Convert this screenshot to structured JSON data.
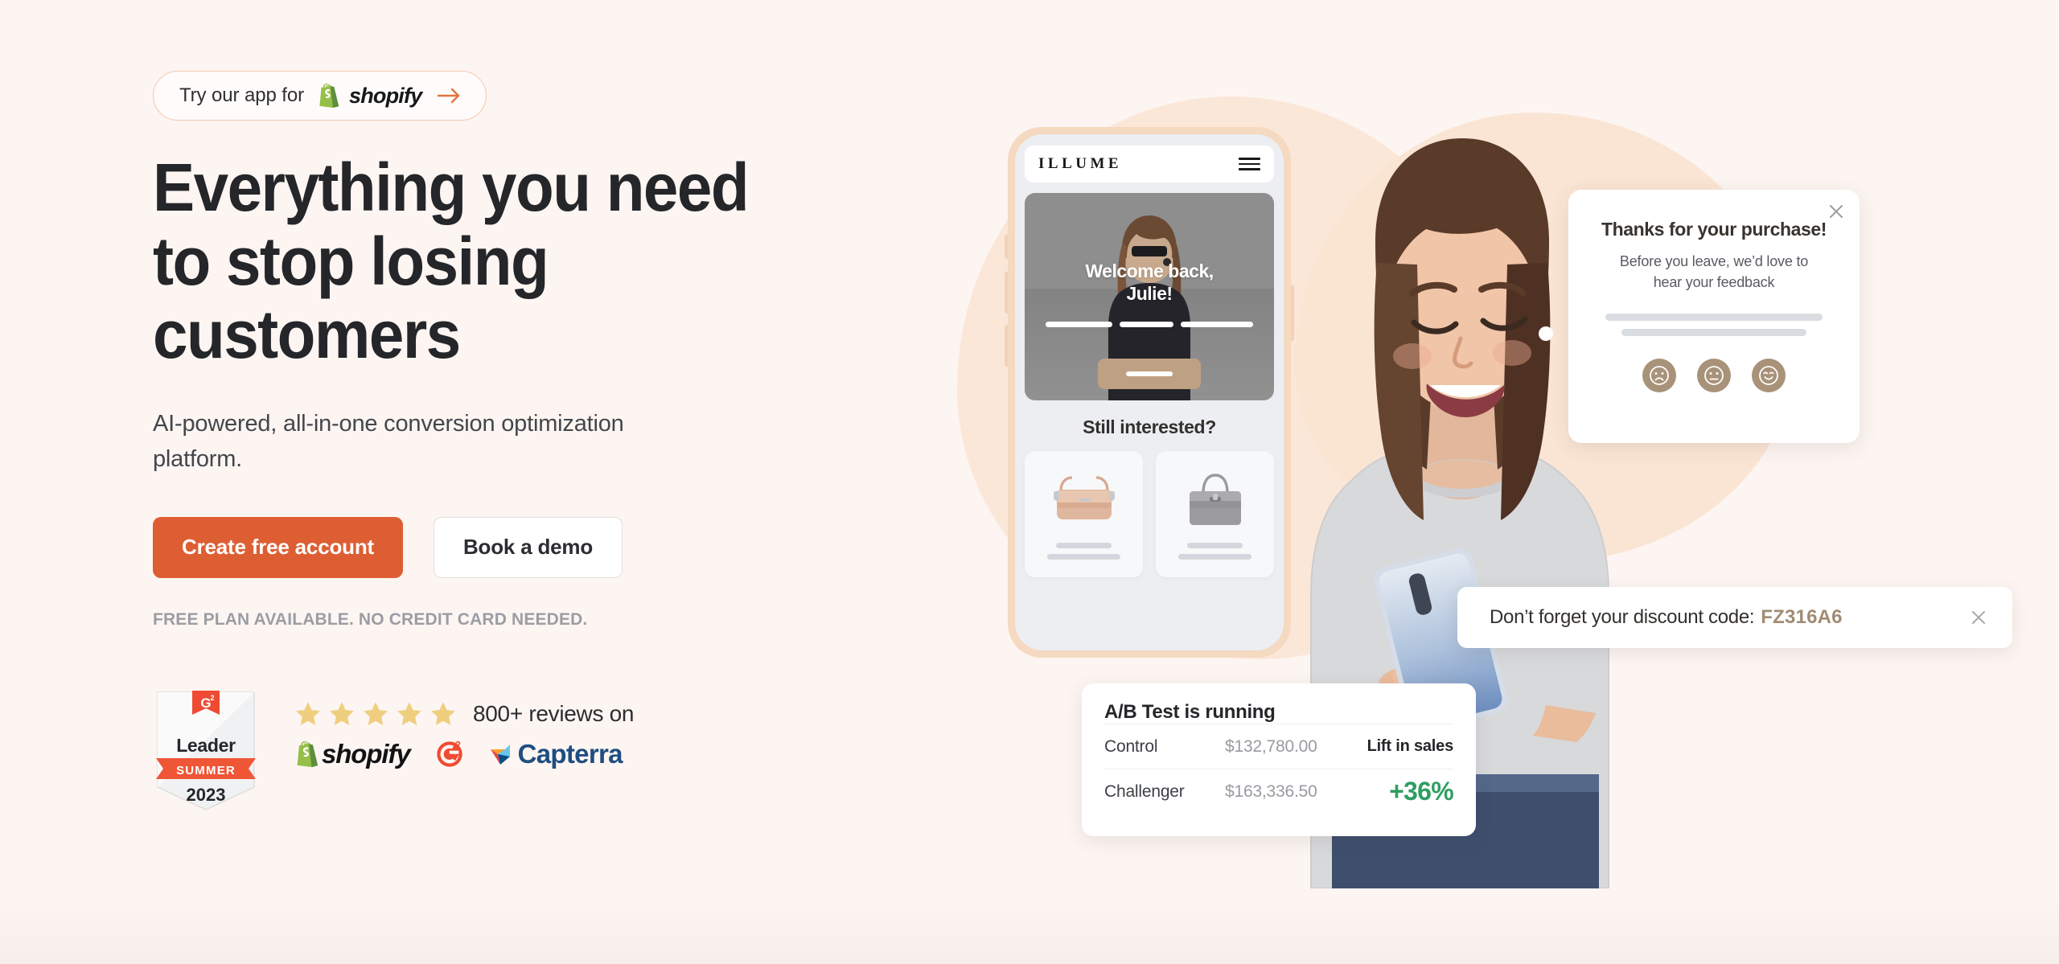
{
  "colors": {
    "page_bg": "#FDF5F1",
    "accent_orange": "#DE5E33",
    "pill_border": "#F3C8B0",
    "blob_peach": "#FBE7D8",
    "star_gold": "#EFCE7F",
    "lift_green": "#2E9E63",
    "discount_code": "#A08C73",
    "emoji_tan": "#A89279",
    "shopify_green": "#95BF47",
    "g2_red": "#EF4B33",
    "capterra_blue": "#1F4D82"
  },
  "promo_pill": {
    "text": "Try our app for",
    "brand": "shopify",
    "bag_icon": "shopify-bag-icon",
    "arrow_icon": "arrow-right-icon"
  },
  "hero": {
    "headline": "Everything you need to stop losing customers",
    "subhead": "AI-powered, all-in-one conversion optimization platform.",
    "primary_cta": "Create free account",
    "secondary_cta": "Book a demo",
    "fineprint": "FREE PLAN AVAILABLE. NO CREDIT CARD NEEDED."
  },
  "social_proof": {
    "badge": {
      "icon": "g2-logo-icon",
      "title": "Leader",
      "season": "SUMMER",
      "year": "2023"
    },
    "stars_count": 5,
    "reviews_text": "800+ reviews on",
    "logos": [
      {
        "name": "shopify-logo",
        "label": "shopify"
      },
      {
        "name": "g2-logo",
        "label": "G2"
      },
      {
        "name": "capterra-logo",
        "label": "Capterra"
      }
    ]
  },
  "phone_mockup": {
    "store_name": "ILLUME",
    "menu_icon": "hamburger-menu-icon",
    "hero_greeting_line1": "Welcome back,",
    "hero_greeting_line2": "Julie!",
    "section_title": "Still interested?",
    "products": [
      {
        "name": "blush-crossbody-bag"
      },
      {
        "name": "grey-tote-bag"
      }
    ]
  },
  "feedback_card": {
    "title": "Thanks for your purchase!",
    "subtitle_line1": "Before you leave, we’d love to",
    "subtitle_line2": "hear your feedback",
    "close_icon": "close-icon",
    "ratings": [
      {
        "name": "sad-face-icon"
      },
      {
        "name": "neutral-face-icon"
      },
      {
        "name": "happy-face-icon"
      }
    ]
  },
  "discount_toast": {
    "text": "Don’t forget your discount code:",
    "code": "FZ316A6",
    "close_icon": "close-icon"
  },
  "ab_test_card": {
    "title": "A/B Test is running",
    "lift_label": "Lift in sales",
    "lift_value": "+36%",
    "rows": [
      {
        "label": "Control",
        "value": "$132,780.00"
      },
      {
        "label": "Challenger",
        "value": "$163,336.50"
      }
    ]
  }
}
